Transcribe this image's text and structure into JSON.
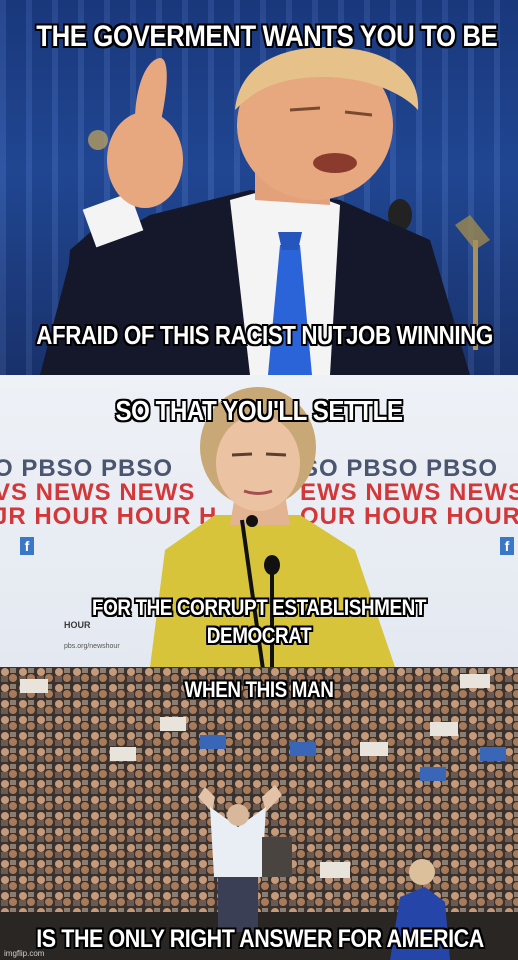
{
  "panels": {
    "top": {
      "caption_top": "THE GOVERMENT WANTS YOU TO BE",
      "caption_bottom": "AFRAID OF THIS RACIST NUTJOB WINNING"
    },
    "middle": {
      "caption_top": "SO THAT YOU'LL SETTLE",
      "caption_line1": "FOR THE CORRUPT ESTABLISHMENT",
      "caption_line2": "DEMOCRAT",
      "backdrop_row1_left": "O PBSO PBSO",
      "backdrop_row2_left": "VS NEWS NEWS",
      "backdrop_row3_left": "JR HOUR HOUR H",
      "backdrop_row1_right": "SO PBSO PBSO",
      "backdrop_row2_right": "EWS NEWS NEWS",
      "backdrop_row3_right": "OUR HOUR HOUR",
      "podium_logo": "HOUR",
      "podium_url": "pbs.org/newshour"
    },
    "bottom": {
      "caption_top": "WHEN THIS MAN",
      "caption_bottom": "IS THE ONLY RIGHT ANSWER FOR AMERICA"
    }
  },
  "watermark": "imgflip.com",
  "colors": {
    "stage_blue": "#234c9e",
    "suit": "#14182a",
    "tie": "#2b63d9",
    "jacket_yellow": "#d8c43a",
    "pbs_red": "#d2373a",
    "caption_text": "#ffffff",
    "caption_outline": "#000000"
  }
}
